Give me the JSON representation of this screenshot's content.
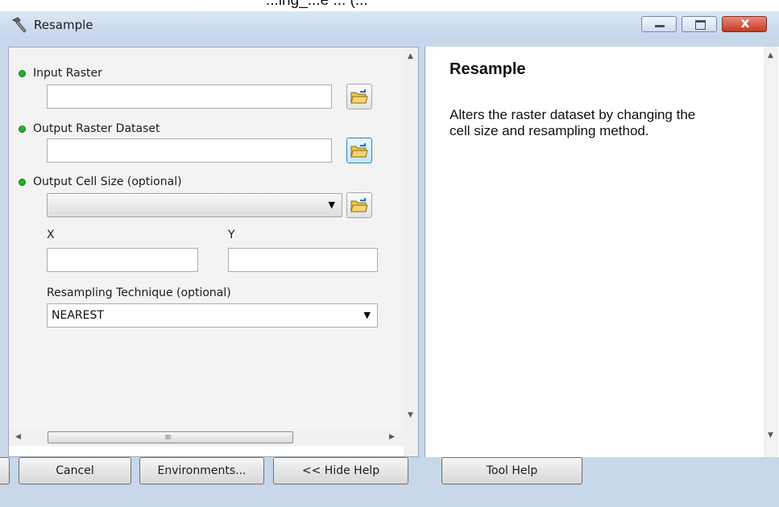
{
  "top_strip": {
    "text": "...ing_...e ... (..."
  },
  "window": {
    "title": "Resample",
    "icon": "hammer-icon",
    "controls": [
      "minimize",
      "maximize",
      "close"
    ],
    "close_glyph": "x"
  },
  "form": {
    "input_raster": {
      "label": "Input Raster",
      "value": ""
    },
    "output_raster": {
      "label": "Output Raster Dataset",
      "value": ""
    },
    "cell_size": {
      "label": "Output Cell Size (optional)",
      "value": ""
    },
    "x": {
      "label": "X",
      "value": ""
    },
    "y": {
      "label": "Y",
      "value": ""
    },
    "technique": {
      "label": "Resampling Technique (optional)",
      "value": "NEAREST"
    },
    "required_indicator_color": "#22b22a",
    "scroll_grip": "III"
  },
  "help": {
    "title": "Resample",
    "description": "Alters the raster dataset by changing the cell size and resampling method."
  },
  "buttons": {
    "cancel": "Cancel",
    "environments": "Environments...",
    "hide_help": "<< Hide Help",
    "tool_help": "Tool Help"
  }
}
